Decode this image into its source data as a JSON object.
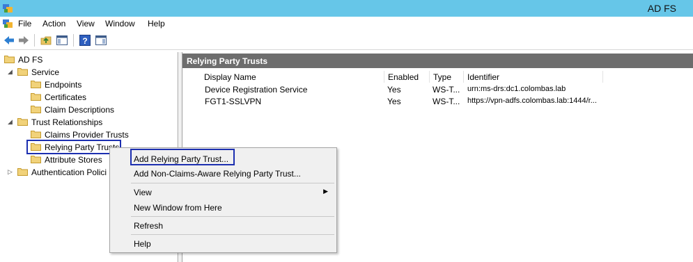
{
  "window": {
    "title": "AD FS"
  },
  "menu": {
    "items": [
      "File",
      "Action",
      "View",
      "Window",
      "Help"
    ]
  },
  "toolbar": {
    "icons": [
      "back-arrow-icon",
      "forward-arrow-icon",
      "up-folder-icon",
      "show-hide-console-tree-icon",
      "help-icon",
      "show-hide-action-pane-icon"
    ]
  },
  "tree": {
    "root": "AD FS",
    "service": "Service",
    "endpoints": "Endpoints",
    "certificates": "Certificates",
    "claim_descriptions": "Claim Descriptions",
    "trust_relationships": "Trust Relationships",
    "claims_provider_trusts": "Claims Provider Trusts",
    "relying_party_trusts": "Relying Party Trusts",
    "attribute_stores": "Attribute Stores",
    "authentication_policies": "Authentication Polici"
  },
  "panel": {
    "title": "Relying Party Trusts",
    "columns": [
      "Display Name",
      "Enabled",
      "Type",
      "Identifier"
    ],
    "rows": [
      [
        "Device Registration Service",
        "Yes",
        "WS-T...",
        "urn:ms-drs:dc1.colombas.lab"
      ],
      [
        "FGT1-SSLVPN",
        "Yes",
        "WS-T...",
        "https://vpn-adfs.colombas.lab:1444/r..."
      ]
    ]
  },
  "context_menu": {
    "add_rpt": "Add Relying Party Trust...",
    "add_non_claims": "Add Non-Claims-Aware Relying Party Trust...",
    "view": "View",
    "new_window": "New Window from Here",
    "refresh": "Refresh",
    "help": "Help"
  },
  "colors": {
    "titlebar": "#66c6e8",
    "panel_header": "#6d6d6d",
    "highlight_box": "#1c2fb0",
    "folder": "#e8c460"
  }
}
